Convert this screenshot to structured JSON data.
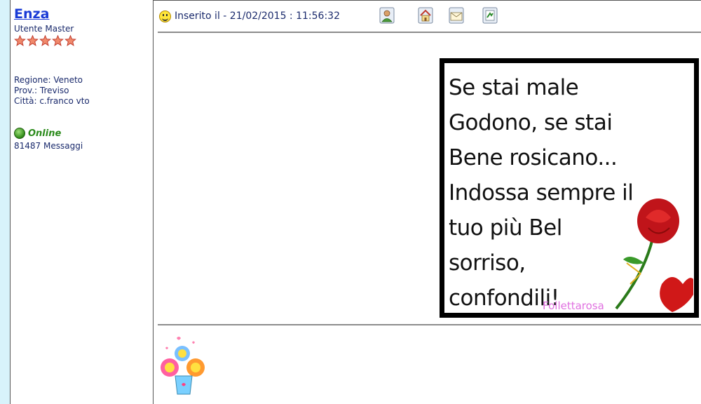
{
  "profile": {
    "username": "Enza",
    "rank": "Utente Master",
    "stars": 5,
    "region": "Regione: Veneto",
    "province": "Prov.: Treviso",
    "city": "Città: c.franco vto",
    "status": "Online",
    "message_count": "81487 Messaggi"
  },
  "post": {
    "posted": "Inserito il - 21/02/2015 : 11:56:32",
    "actions": [
      "profile-icon",
      "homepage-icon",
      "email-icon",
      "reply-quote-icon"
    ]
  },
  "image": {
    "quote": "Se stai male godono, se stai bene rosicano... Indossa sempre il tuo più bel sorriso, confondili!",
    "lines": [
      "Se stai male",
      "Godono, se stai",
      "Bene rosicano...",
      "Indossa sempre il",
      "tuo più Bel",
      "sorriso,",
      "confondili!"
    ],
    "signature": "Follettarosa"
  },
  "colors": {
    "link": "#1a3bd6",
    "text": "#1a2a6c",
    "online": "#2a8a1a",
    "gutter": "#d8f3fb"
  }
}
